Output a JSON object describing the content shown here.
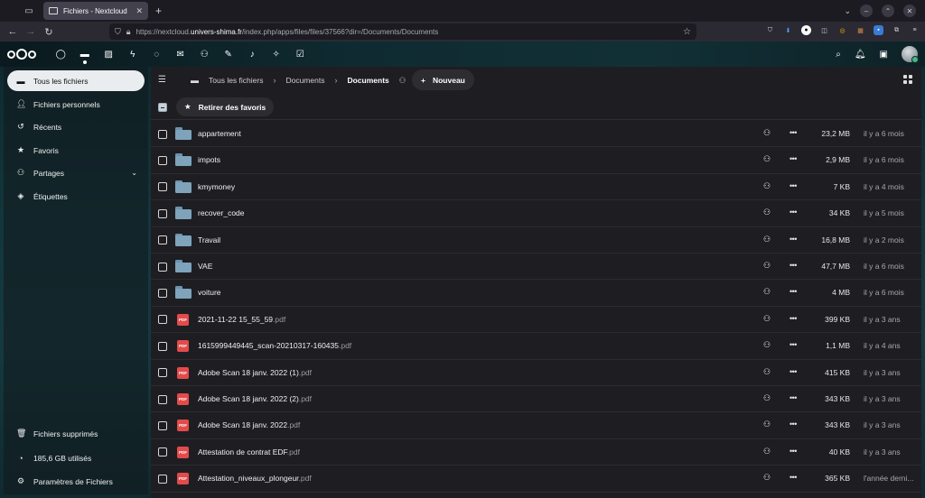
{
  "browser": {
    "tab_title": "Fichiers - Nextcloud",
    "url_prefix": "https://nextcloud.",
    "url_domain": "univers-shima.fr",
    "url_path": "/index.php/apps/files/files/37566?dir=/Documents/Documents"
  },
  "sidebar": {
    "items": [
      {
        "label": "Tous les fichiers",
        "icon": "folder-icon"
      },
      {
        "label": "Fichiers personnels",
        "icon": "user-icon"
      },
      {
        "label": "Récents",
        "icon": "history-icon"
      },
      {
        "label": "Favoris",
        "icon": "star-icon"
      },
      {
        "label": "Partages",
        "icon": "share-icon"
      },
      {
        "label": "Étiquettes",
        "icon": "tag-icon"
      }
    ],
    "footer": {
      "trash": "Fichiers supprimés",
      "quota": "185,6 GB utilisés",
      "settings": "Paramètres de Fichiers"
    }
  },
  "breadcrumb": {
    "root": "Tous les fichiers",
    "parent": "Documents",
    "current": "Documents"
  },
  "toolbar": {
    "new_label": "Nouveau",
    "unfavorite_label": "Retirer des favoris"
  },
  "files": [
    {
      "name": "appartement",
      "ext": "",
      "type": "folder",
      "size": "23,2 MB",
      "date": "il y a 6 mois"
    },
    {
      "name": "impots",
      "ext": "",
      "type": "folder",
      "size": "2,9 MB",
      "date": "il y a 6 mois"
    },
    {
      "name": "kmymoney",
      "ext": "",
      "type": "folder",
      "size": "7 KB",
      "date": "il y a 4 mois"
    },
    {
      "name": "recover_code",
      "ext": "",
      "type": "folder",
      "size": "34 KB",
      "date": "il y a 5 mois"
    },
    {
      "name": "Travail",
      "ext": "",
      "type": "folder",
      "size": "16,8 MB",
      "date": "il y a 2 mois"
    },
    {
      "name": "VAE",
      "ext": "",
      "type": "folder",
      "size": "47,7 MB",
      "date": "il y a 6 mois"
    },
    {
      "name": "voiture",
      "ext": "",
      "type": "folder",
      "size": "4 MB",
      "date": "il y a 6 mois"
    },
    {
      "name": "2021-11-22 15_55_59",
      "ext": ".pdf",
      "type": "pdf",
      "size": "399 KB",
      "date": "il y a 3 ans"
    },
    {
      "name": "1615999449445_scan-20210317-160435",
      "ext": ".pdf",
      "type": "pdf",
      "size": "1,1 MB",
      "date": "il y a 4 ans"
    },
    {
      "name": "Adobe Scan 18 janv. 2022 (1)",
      "ext": ".pdf",
      "type": "pdf",
      "size": "415 KB",
      "date": "il y a 3 ans"
    },
    {
      "name": "Adobe Scan 18 janv. 2022 (2)",
      "ext": ".pdf",
      "type": "pdf",
      "size": "343 KB",
      "date": "il y a 3 ans"
    },
    {
      "name": "Adobe Scan 18 janv. 2022",
      "ext": ".pdf",
      "type": "pdf",
      "size": "343 KB",
      "date": "il y a 3 ans"
    },
    {
      "name": "Attestation de contrat EDF",
      "ext": ".pdf",
      "type": "pdf",
      "size": "40 KB",
      "date": "il y a 3 ans"
    },
    {
      "name": "Attestation_niveaux_plongeur",
      "ext": ".pdf",
      "type": "pdf",
      "size": "365 KB",
      "date": "l'année derni..."
    }
  ],
  "colors": {
    "accent_active": "#e9edf0",
    "folder": "#7ea3ba",
    "pdf": "#e34b4b",
    "main_bg": "#1e1e22"
  }
}
